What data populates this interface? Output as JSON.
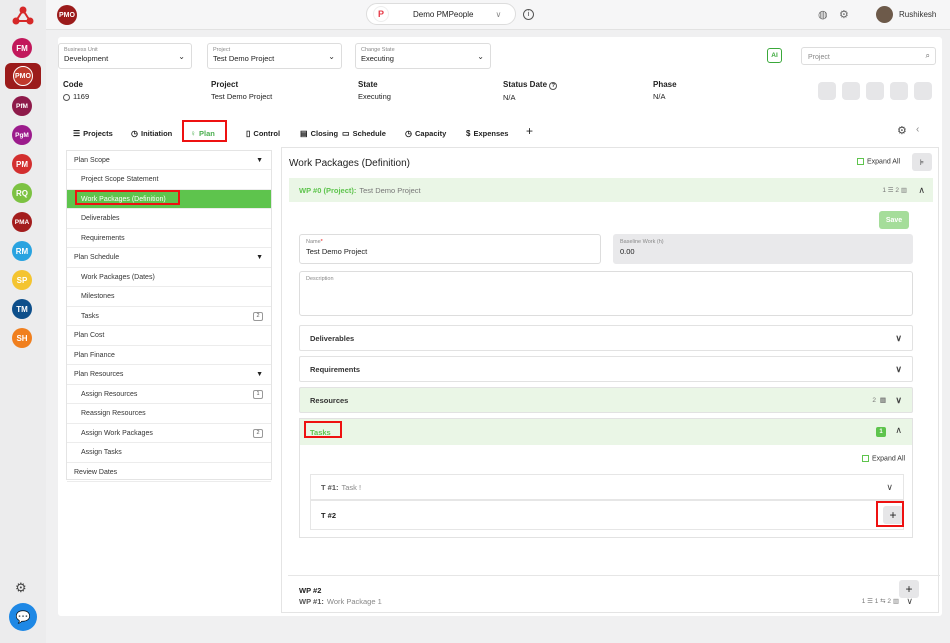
{
  "app_selector": {
    "label": "Demo PMPeople"
  },
  "user": {
    "name": "Rushikesh"
  },
  "logo": {
    "text": "PMO"
  },
  "rail": [
    {
      "text": "FM",
      "color": "#c2185b"
    },
    {
      "text": "PMO",
      "color": "#c0392b"
    },
    {
      "text": "PfM",
      "color": "#8e1a4a"
    },
    {
      "text": "PgM",
      "color": "#9c1b8c"
    },
    {
      "text": "PM",
      "color": "#d32f2f"
    },
    {
      "text": "RQ",
      "color": "#7cc242"
    },
    {
      "text": "PMA",
      "color": "#a31d1d"
    },
    {
      "text": "RM",
      "color": "#29a3e0"
    },
    {
      "text": "SP",
      "color": "#f4c430"
    },
    {
      "text": "TM",
      "color": "#0d4f8b"
    },
    {
      "text": "SH",
      "color": "#f07f1e"
    }
  ],
  "filters": {
    "business_unit": {
      "label": "Business Unit",
      "value": "Development"
    },
    "project": {
      "label": "Project",
      "value": "Test Demo Project"
    },
    "change_state": {
      "label": "Change State",
      "value": "Executing"
    },
    "search_placeholder": "Project"
  },
  "info": {
    "code": {
      "label": "Code",
      "value": "1169"
    },
    "project": {
      "label": "Project",
      "value": "Test Demo Project"
    },
    "state": {
      "label": "State",
      "value": "Executing"
    },
    "status_date": {
      "label": "Status Date",
      "value": "N/A"
    },
    "phase": {
      "label": "Phase",
      "value": "N/A"
    }
  },
  "tabs": [
    {
      "label": "Projects",
      "icon": "list-icon"
    },
    {
      "label": "Initiation",
      "icon": "clock-icon"
    },
    {
      "label": "Plan",
      "icon": "bulb-icon"
    },
    {
      "label": "Control",
      "icon": "control-icon"
    },
    {
      "label": "Closing",
      "icon": "closing-icon"
    },
    {
      "label": "Schedule",
      "icon": "schedule-icon"
    },
    {
      "label": "Capacity",
      "icon": "clock-icon"
    },
    {
      "label": "Expenses",
      "icon": "dollar-icon"
    }
  ],
  "tree": [
    {
      "label": "Plan Scope",
      "type": "sec",
      "caret": true
    },
    {
      "label": "Project Scope Statement",
      "type": "sub"
    },
    {
      "label": "Work Packages (Definition)",
      "type": "sub",
      "active": true
    },
    {
      "label": "Deliverables",
      "type": "sub"
    },
    {
      "label": "Requirements",
      "type": "sub"
    },
    {
      "label": "Plan Schedule",
      "type": "sec",
      "caret": true
    },
    {
      "label": "Work Packages (Dates)",
      "type": "sub"
    },
    {
      "label": "Milestones",
      "type": "sub"
    },
    {
      "label": "Tasks",
      "type": "sub",
      "badge": "2"
    },
    {
      "label": "Plan Cost",
      "type": "sec"
    },
    {
      "label": "Plan Finance",
      "type": "sec"
    },
    {
      "label": "Plan Resources",
      "type": "sec",
      "caret": true
    },
    {
      "label": "Assign Resources",
      "type": "sub",
      "badge": "1"
    },
    {
      "label": "Reassign Resources",
      "type": "sub"
    },
    {
      "label": "Assign Work Packages",
      "type": "sub",
      "badge": "2"
    },
    {
      "label": "Assign Tasks",
      "type": "sub"
    },
    {
      "label": "Review Dates",
      "type": "sec"
    }
  ],
  "panel": {
    "title": "Work Packages (Definition)",
    "expand_all": "Expand All",
    "wp0": {
      "prefix": "WP #0 (Project):",
      "name": "Test Demo Project",
      "counts": "1 ☰ 2 ▥"
    },
    "save": "Save",
    "name_field": {
      "label": "Name",
      "value": "Test Demo Project"
    },
    "baseline_field": {
      "label": "Baseline Work (h)",
      "value": "0.00"
    },
    "description_field": {
      "label": "Description"
    },
    "deliverables": "Deliverables",
    "requirements": "Requirements",
    "resources": {
      "label": "Resources",
      "count": "2"
    },
    "tasks": {
      "label": "Tasks",
      "count": "1"
    },
    "tasks_expand_all": "Expand All",
    "t1": {
      "prefix": "T #1:",
      "name": "Task !"
    },
    "t2": "T #2",
    "wp1": {
      "prefix": "WP #1:",
      "name": "Work Package 1",
      "counts": "1 ☰ 1 ⇆ 2 ▥"
    },
    "wp2": "WP #2"
  }
}
